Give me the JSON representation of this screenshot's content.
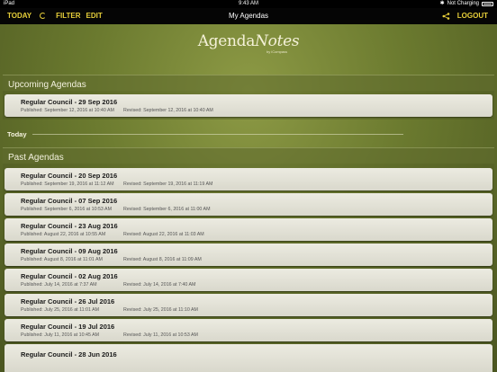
{
  "status_bar": {
    "device": "iPad",
    "time": "9:43 AM",
    "charging": "Not Charging"
  },
  "nav": {
    "today": "TODAY",
    "filter": "FILTER",
    "edit": "EDIT",
    "title": "My Agendas",
    "logout": "LOGOUT"
  },
  "logo": {
    "name_main": "Agenda",
    "name_italic": "Notes",
    "byline": "by iCompass"
  },
  "upcoming": {
    "header": "Upcoming Agendas",
    "items": [
      {
        "title": "Regular Council - 29 Sep 2016",
        "published": "Published: September 12, 2016 at 10:40 AM",
        "revised": "Revised: September 12, 2016 at 10:40 AM"
      }
    ]
  },
  "today_label": "Today",
  "past": {
    "header": "Past Agendas",
    "items": [
      {
        "title": "Regular Council - 20 Sep 2016",
        "published": "Published: September 19, 2016 at 11:12 AM",
        "revised": "Revised: September 19, 2016 at 11:19 AM"
      },
      {
        "title": "Regular Council - 07 Sep 2016",
        "published": "Published: September 6, 2016 at 10:53 AM",
        "revised": "Revised: September 6, 2016 at 11:00 AM"
      },
      {
        "title": "Regular Council - 23 Aug 2016",
        "published": "Published: August 22, 2016 at 10:55 AM",
        "revised": "Revised: August 22, 2016 at 11:03 AM"
      },
      {
        "title": "Regular Council - 09 Aug 2016",
        "published": "Published: August 8, 2016 at 11:01 AM",
        "revised": "Revised: August 8, 2016 at 11:09 AM"
      },
      {
        "title": "Regular Council - 02 Aug 2016",
        "published": "Published: July 14, 2016 at 7:37 AM",
        "revised": "Revised: July 14, 2016 at 7:40 AM"
      },
      {
        "title": "Regular Council - 26 Jul 2016",
        "published": "Published: July 25, 2016 at 11:01 AM",
        "revised": "Revised: July 25, 2016 at 11:10 AM"
      },
      {
        "title": "Regular Council - 19 Jul 2016",
        "published": "Published: July 11, 2016 at 10:45 AM",
        "revised": "Revised: July 11, 2016 at 10:53 AM"
      },
      {
        "title": "Regular Council - 28 Jun 2016",
        "published": "",
        "revised": ""
      }
    ]
  },
  "colors": {
    "accent": "#e7cf3a",
    "background": "#6b7a2f",
    "card": "#e5e4d8"
  },
  "icons": {
    "refresh": "refresh-icon",
    "share": "share-icon",
    "bluetooth": "bluetooth-icon",
    "wifi": "wifi-icon",
    "battery": "battery-icon"
  }
}
